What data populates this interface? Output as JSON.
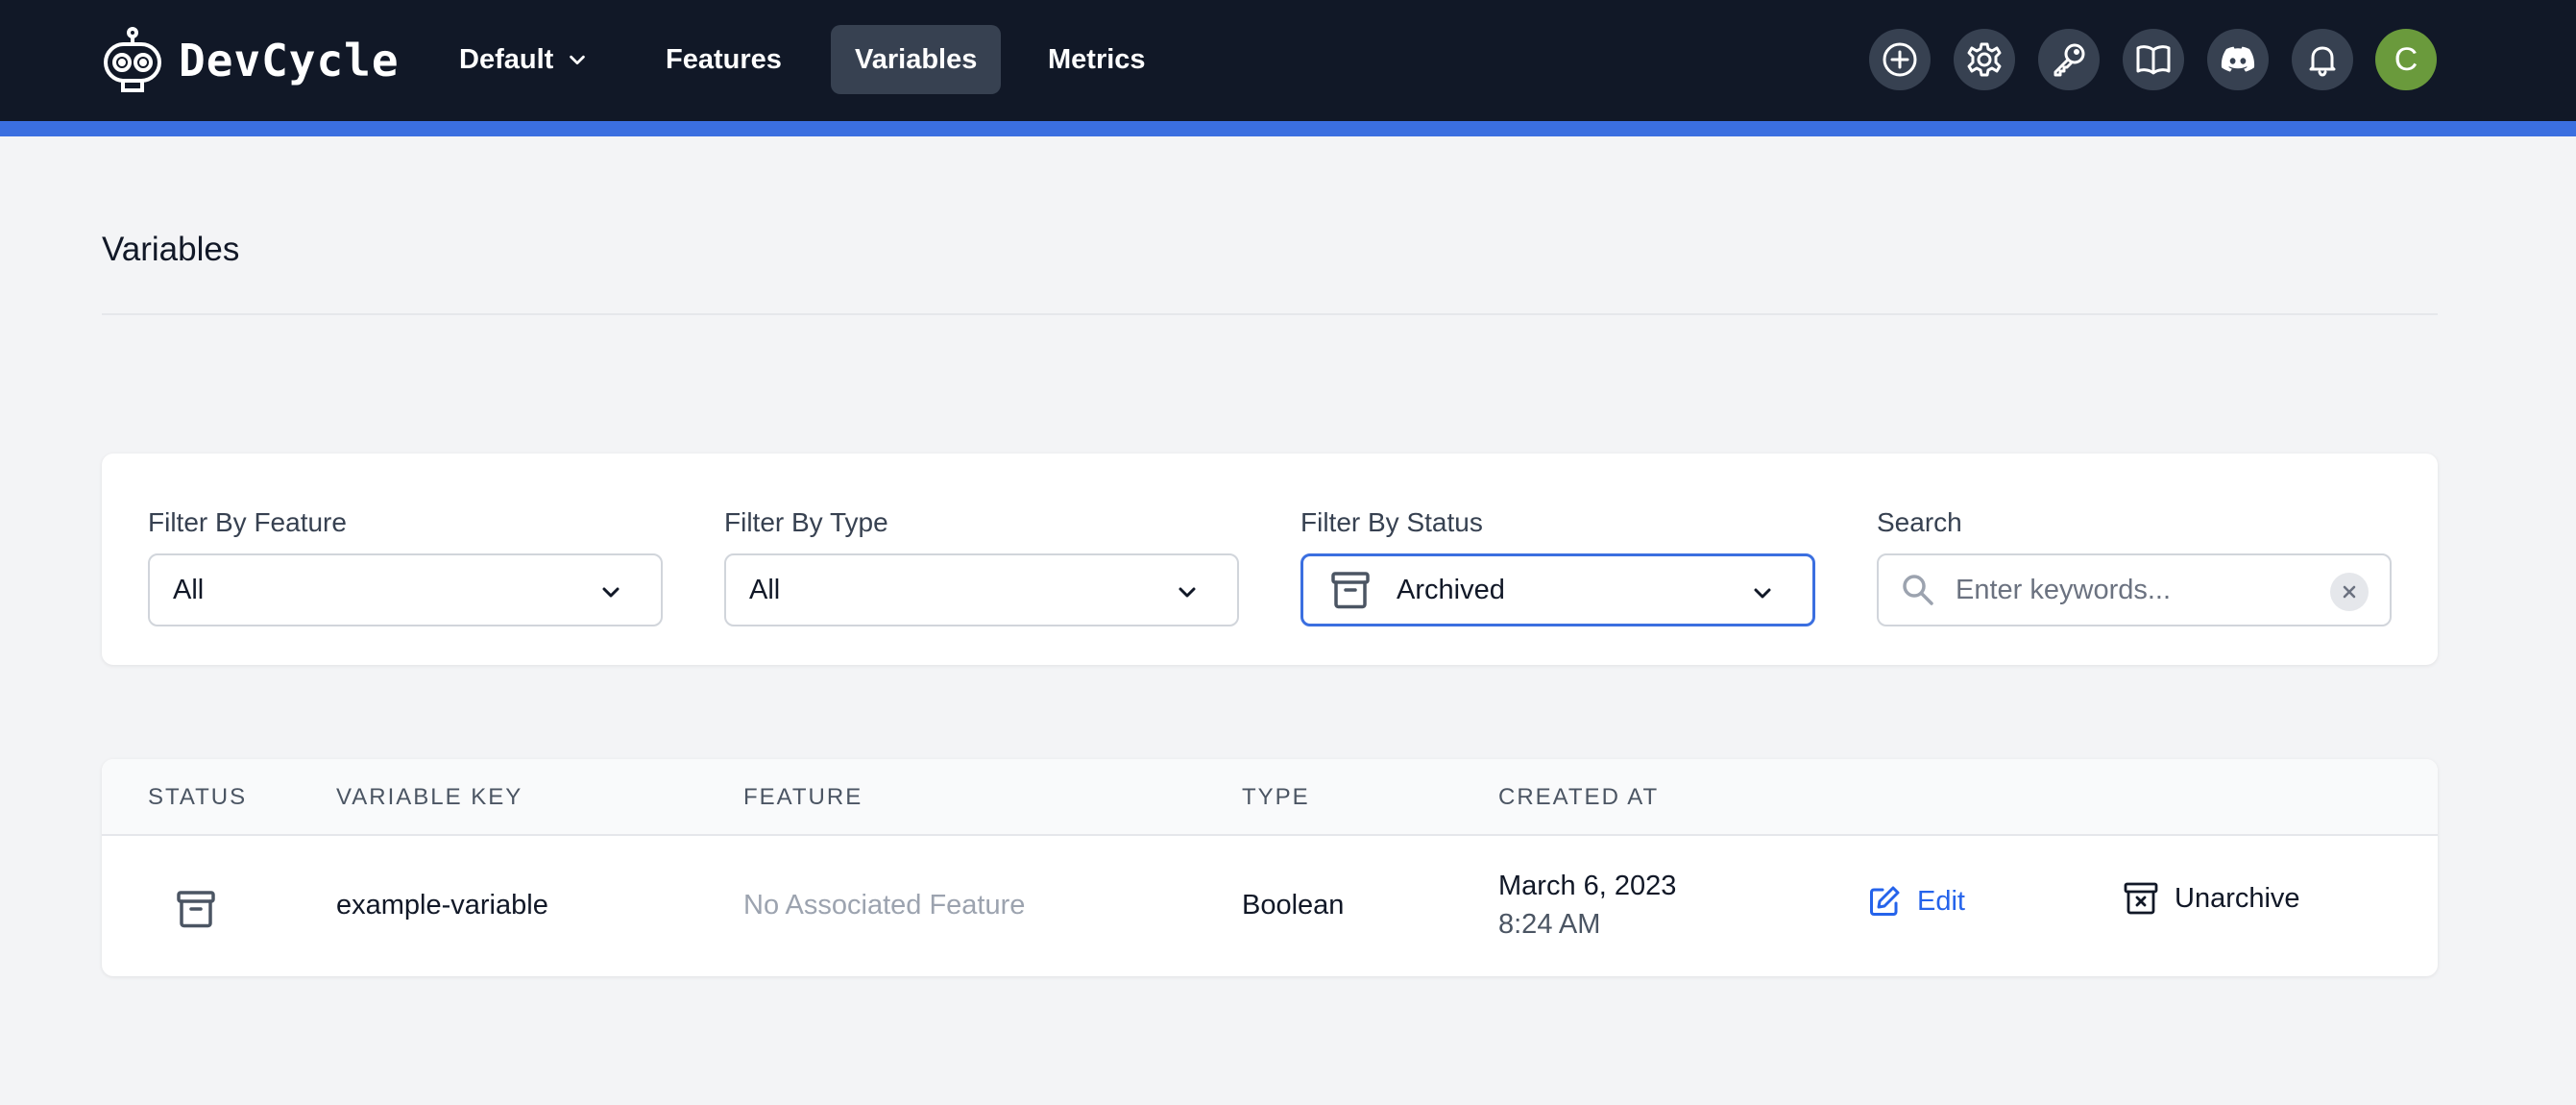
{
  "app": {
    "name": "DevCycle"
  },
  "nav": {
    "environment": "Default",
    "items": [
      "Features",
      "Variables",
      "Metrics"
    ],
    "active": "Variables",
    "icons": [
      "plus-circle-icon",
      "gear-icon",
      "key-icon",
      "book-open-icon",
      "discord-icon",
      "bell-icon"
    ],
    "avatar_initial": "C"
  },
  "colors": {
    "nav_bg": "#111827",
    "accent": "#3b6fe0",
    "avatar": "#6a9a3c",
    "link": "#2563eb"
  },
  "page": {
    "title": "Variables"
  },
  "filters": {
    "feature": {
      "label": "Filter By Feature",
      "value": "All"
    },
    "type": {
      "label": "Filter By Type",
      "value": "All"
    },
    "status": {
      "label": "Filter By Status",
      "value": "Archived",
      "icon": "archive-icon"
    },
    "search": {
      "label": "Search",
      "placeholder": "Enter keywords..."
    }
  },
  "table": {
    "columns": [
      "Status",
      "Variable Key",
      "Feature",
      "Type",
      "Created At"
    ],
    "rows": [
      {
        "status_icon": "archive-icon",
        "key": "example-variable",
        "feature": "No Associated Feature",
        "type": "Boolean",
        "created_date": "March 6, 2023",
        "created_time": "8:24 AM",
        "edit_label": "Edit",
        "unarchive_label": "Unarchive"
      }
    ]
  }
}
